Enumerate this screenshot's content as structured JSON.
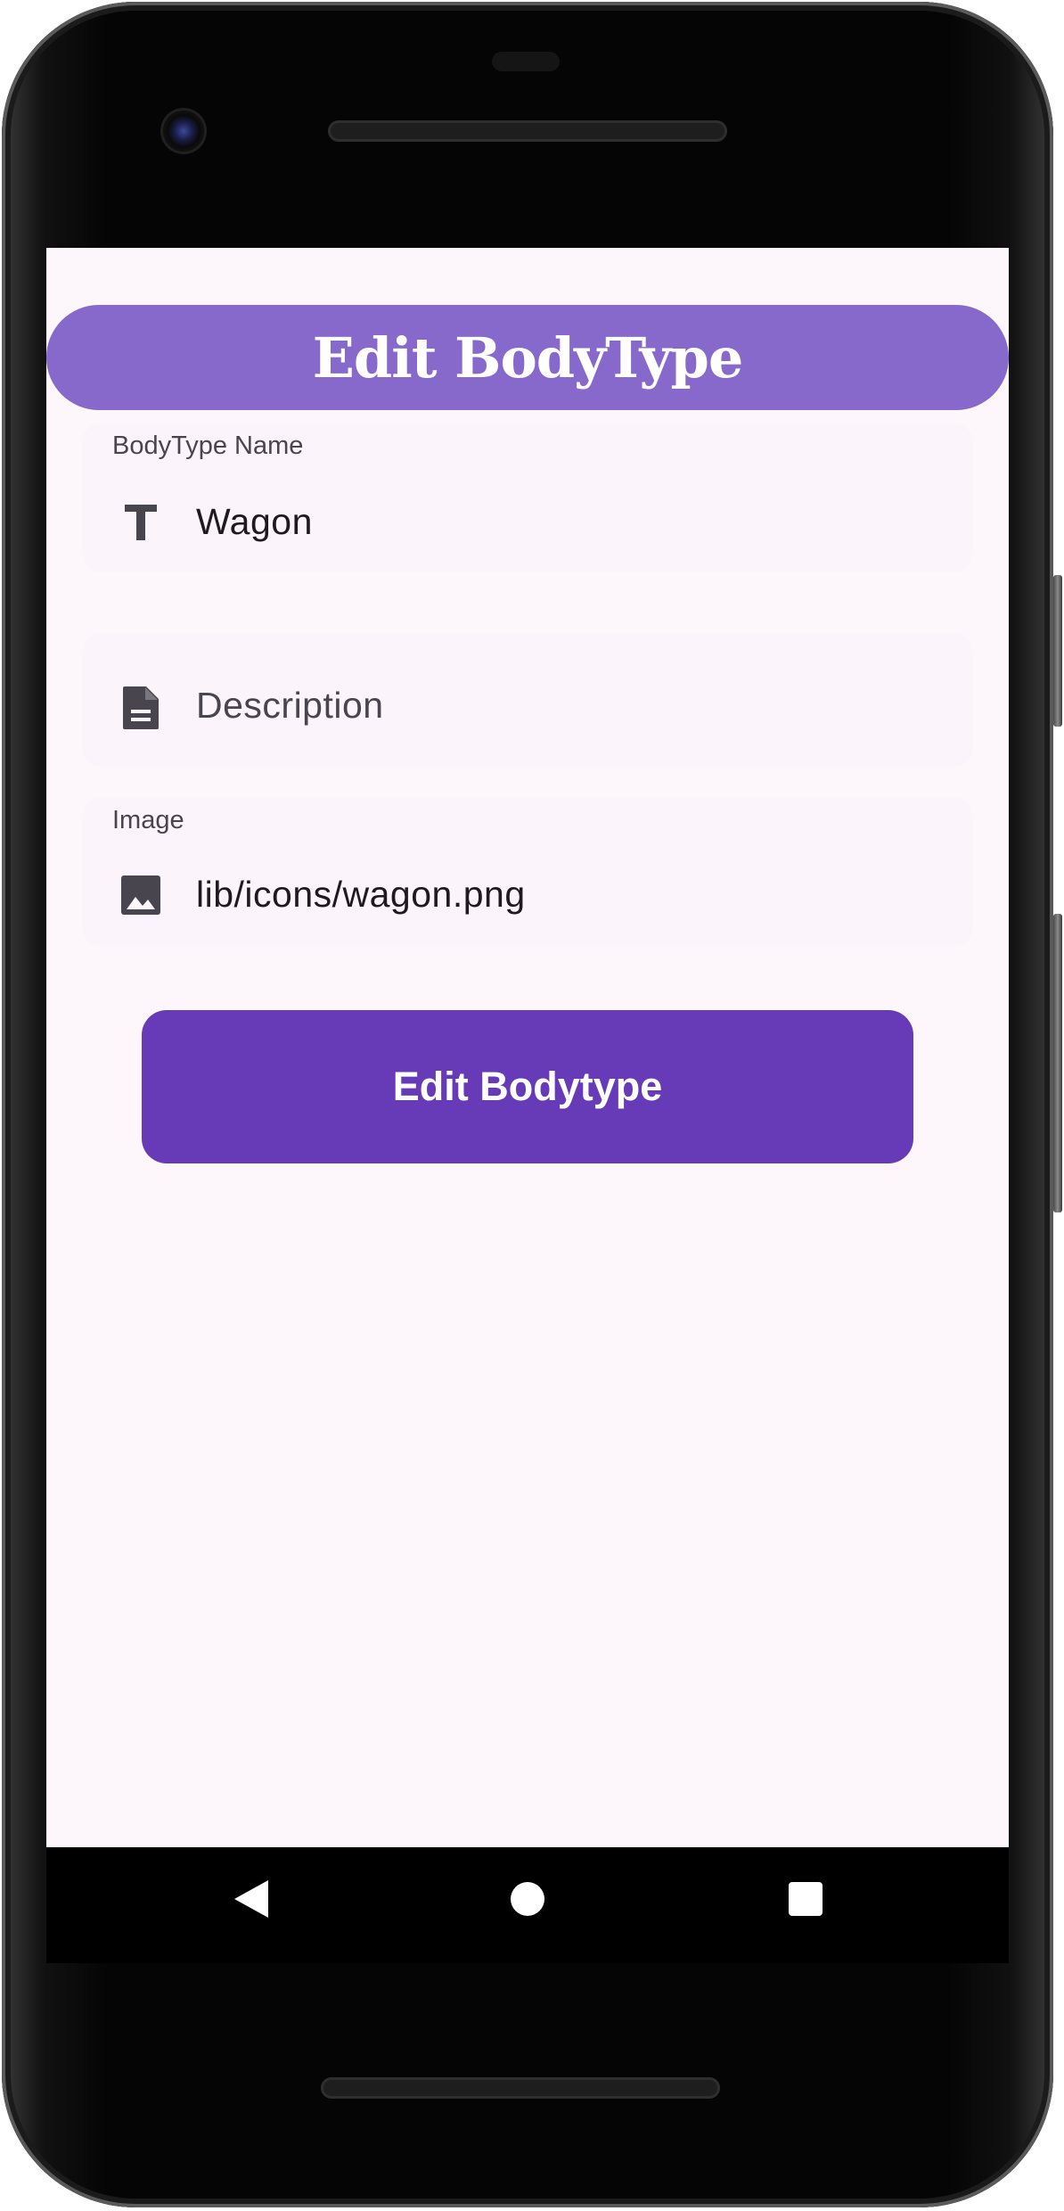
{
  "app_bar": {
    "title": "Edit BodyType"
  },
  "form": {
    "name_field": {
      "label": "BodyType Name",
      "value": "Wagon",
      "icon": "text-fields-icon"
    },
    "description_field": {
      "placeholder": "Description",
      "icon": "description-document-icon"
    },
    "image_field": {
      "label": "Image",
      "value": "lib/icons/wagon.png",
      "icon": "image-icon"
    },
    "submit_label": "Edit Bodytype"
  },
  "nav": {
    "back": "back-triangle-icon",
    "home": "home-circle-icon",
    "recents": "recents-square-icon"
  },
  "colors": {
    "app_bar": "#8769cc",
    "primary_button": "#673ab7",
    "background": "#fdf7fc",
    "icon": "#49454f"
  }
}
